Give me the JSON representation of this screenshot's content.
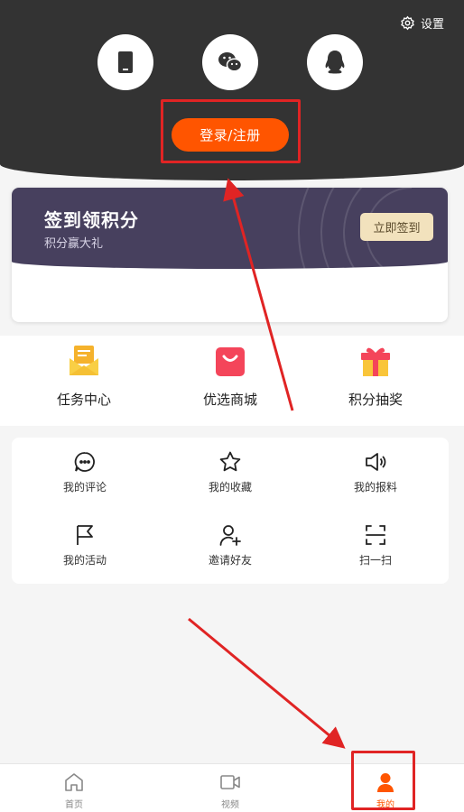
{
  "header": {
    "settings_label": "设置",
    "login_button": "登录/注册",
    "login_methods": [
      "phone-icon",
      "wechat-icon",
      "qq-icon"
    ],
    "bg_color": "#333333",
    "accent_color": "#ff5500"
  },
  "signin": {
    "title": "签到领积分",
    "subtitle": "积分赢大礼",
    "button": "立即签到"
  },
  "quick": [
    {
      "label": "任务中心",
      "icon": "task-envelope-icon"
    },
    {
      "label": "优选商城",
      "icon": "shopping-bag-icon"
    },
    {
      "label": "积分抽奖",
      "icon": "gift-box-icon"
    }
  ],
  "menu": [
    {
      "label": "我的评论",
      "icon": "comment-icon"
    },
    {
      "label": "我的收藏",
      "icon": "star-icon"
    },
    {
      "label": "我的报料",
      "icon": "speaker-icon"
    },
    {
      "label": "我的活动",
      "icon": "flag-icon"
    },
    {
      "label": "邀请好友",
      "icon": "add-user-icon"
    },
    {
      "label": "扫一扫",
      "icon": "scan-icon"
    }
  ],
  "tabbar": [
    {
      "label": "首页",
      "icon": "home-icon"
    },
    {
      "label": "视频",
      "icon": "video-icon"
    },
    {
      "label": "我的",
      "icon": "user-icon",
      "active": true
    }
  ],
  "annotation_color": "#e02424"
}
